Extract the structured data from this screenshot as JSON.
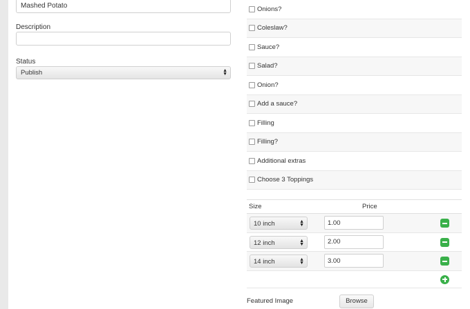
{
  "form": {
    "name_value": "Mashed Potato",
    "description_label": "Description",
    "description_value": "",
    "status_label": "Status",
    "status_value": "Publish"
  },
  "options": [
    {
      "label": "Onions?",
      "checked": false
    },
    {
      "label": "Coleslaw?",
      "checked": false
    },
    {
      "label": "Sauce?",
      "checked": false
    },
    {
      "label": "Salad?",
      "checked": false
    },
    {
      "label": "Onion?",
      "checked": false
    },
    {
      "label": "Add a sauce?",
      "checked": false
    },
    {
      "label": "Filling",
      "checked": false
    },
    {
      "label": "Filling?",
      "checked": false
    },
    {
      "label": "Additional extras",
      "checked": false
    },
    {
      "label": "Choose 3 Toppings",
      "checked": false
    }
  ],
  "prices": {
    "size_header": "Size",
    "price_header": "Price",
    "rows": [
      {
        "size": "10 inch",
        "price": "1.00"
      },
      {
        "size": "12 inch",
        "price": "2.00"
      },
      {
        "size": "14 inch",
        "price": "3.00"
      }
    ]
  },
  "featured": {
    "label": "Featured Image",
    "browse_label": "Browse"
  },
  "colors": {
    "accent_green": "#3ab04a",
    "background": "#e9e9e9"
  }
}
